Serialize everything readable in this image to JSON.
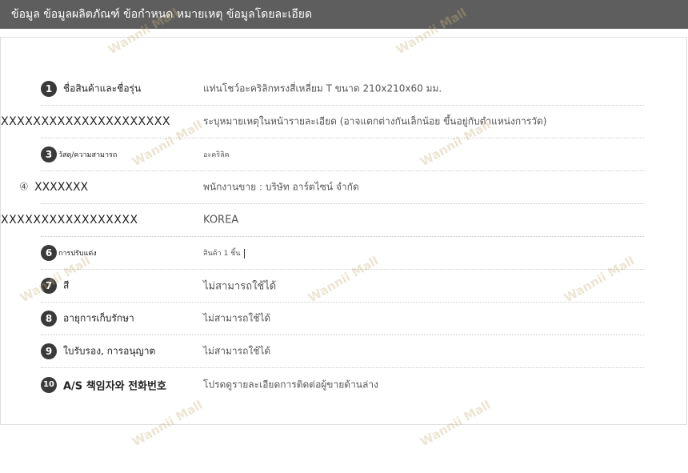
{
  "header": {
    "title": "ข้อมูล ข้อมูลผลิตภัณฑ์ ข้อกำหนด หมายเหตุ ข้อมูลโดยละเอียด"
  },
  "watermark_text": "Wannii Mall",
  "rows": [
    {
      "number": "1",
      "label": "ชื่อสินค้าและชื่อรุ่น",
      "value": "แท่นโชว์อะคริลิกทรงสี่เหลี่ยม T ขนาด 210x210x60 มม."
    },
    {
      "number": "",
      "label": "XXXXXXXXXXXXXXXXXXXXX",
      "value": "ระบุหมายเหตุในหน้ารายละเอียด (อาจแตกต่างกันเล็กน้อย ขึ้นอยู่กับตำแหน่งการวัด)"
    },
    {
      "number": "3",
      "label": "วัสดุ/ความสามารถ",
      "value": "อะคริลิค"
    },
    {
      "number": "④",
      "label": "XXXXXXX",
      "value": "พนักงานขาย : บริษัท อาร์ตไซน์ จำกัด"
    },
    {
      "number": "",
      "label": "XXXXXXXXXXXXXXXXX",
      "value": "KOREA"
    },
    {
      "number": "6",
      "label": "การปรับแต่ง",
      "value": "สินค้า 1 ชิ้น"
    },
    {
      "number": "7",
      "label": "สี",
      "value": "ไม่สามารถใช้ได้"
    },
    {
      "number": "8",
      "label": "อายุการเก็บรักษา",
      "value": "ไม่สามารถใช้ได้"
    },
    {
      "number": "9",
      "label": "ใบรับรอง, การอนุญาต",
      "value": "ไม่สามารถใช้ได้"
    },
    {
      "number": "10",
      "label": "A/S 책임자와 전화번호",
      "value": "โปรดดูรายละเอียดการติดต่อผู้ขายด้านล่าง"
    }
  ]
}
